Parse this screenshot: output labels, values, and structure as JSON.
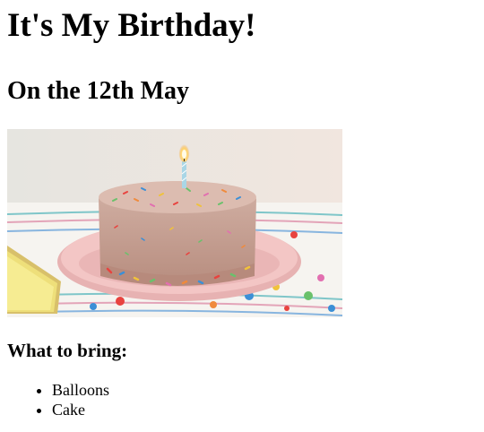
{
  "page": {
    "title": "It's My Birthday!",
    "subtitle": "On the 12th May",
    "section_heading": "What to bring:",
    "bring_items": [
      {
        "label": "Balloons"
      },
      {
        "label": "Cake"
      }
    ]
  },
  "colors": {
    "text": "#000000",
    "background": "#ffffff",
    "cake_frosting": "#c9a497",
    "plate": "#f0bcbc"
  }
}
